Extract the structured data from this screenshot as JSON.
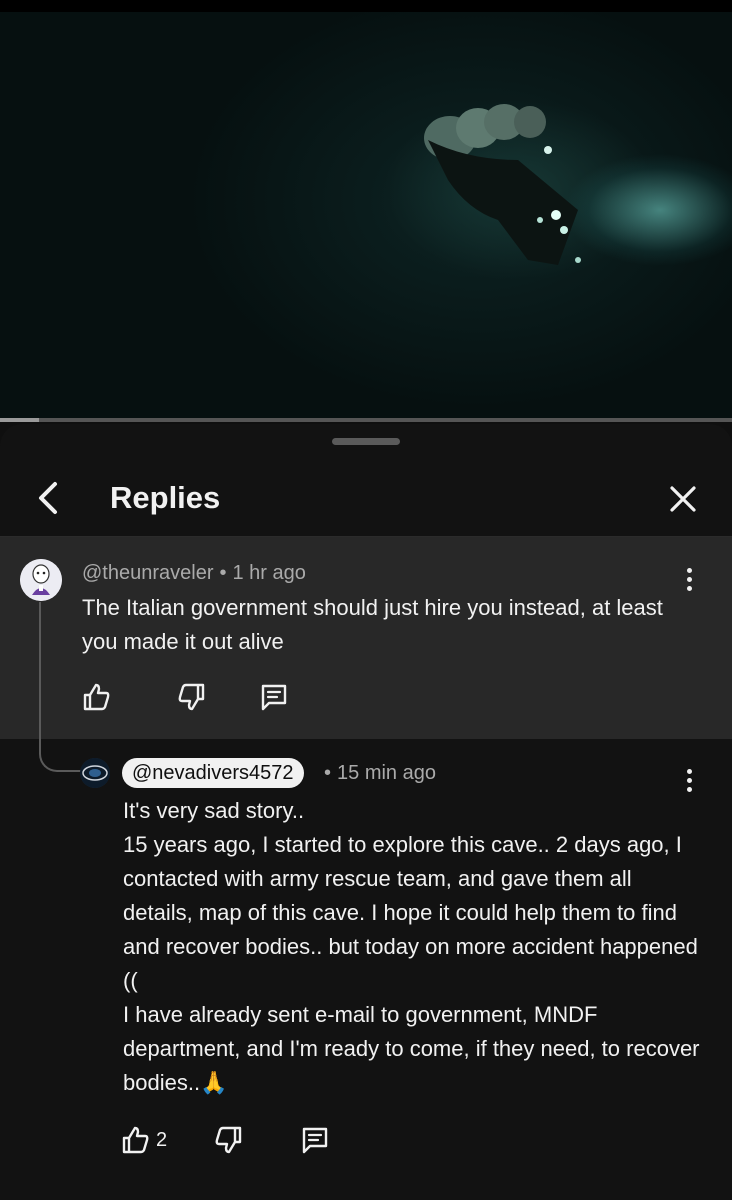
{
  "video": {
    "progress_fraction": 0.053
  },
  "sheet": {
    "title": "Replies",
    "back_icon": "chevron-left-icon",
    "close_icon": "close-icon"
  },
  "parent_comment": {
    "author": "@theunraveler",
    "separator": "•",
    "time": "1 hr ago",
    "text": "The Italian government should just hire you instead, at least you made it out alive",
    "like_count": "",
    "icons": [
      "thumbs-up-icon",
      "thumbs-down-icon",
      "reply-icon",
      "more-vertical-icon"
    ]
  },
  "reply": {
    "author": "@nevadivers4572",
    "separator": "•",
    "time": "15 min ago",
    "text": "It's very sad story..\n15 years ago, I started to explore this cave.. 2 days ago, I contacted with army rescue team,  and gave them all details, map of this cave. I hope it could help them to find and recover bodies.. but today on more accident happened ((\nI have already sent e-mail to  government, MNDF department,  and I'm ready to come, if they need, to recover bodies..🙏",
    "like_count": "2",
    "icons": [
      "thumbs-up-icon",
      "thumbs-down-icon",
      "reply-icon",
      "more-vertical-icon"
    ]
  },
  "colors": {
    "background": "#0f0f0f",
    "sheet": "#121212",
    "highlighted_comment": "#282828",
    "text_primary": "#f1f1f1",
    "text_secondary": "#aaaaaa"
  }
}
